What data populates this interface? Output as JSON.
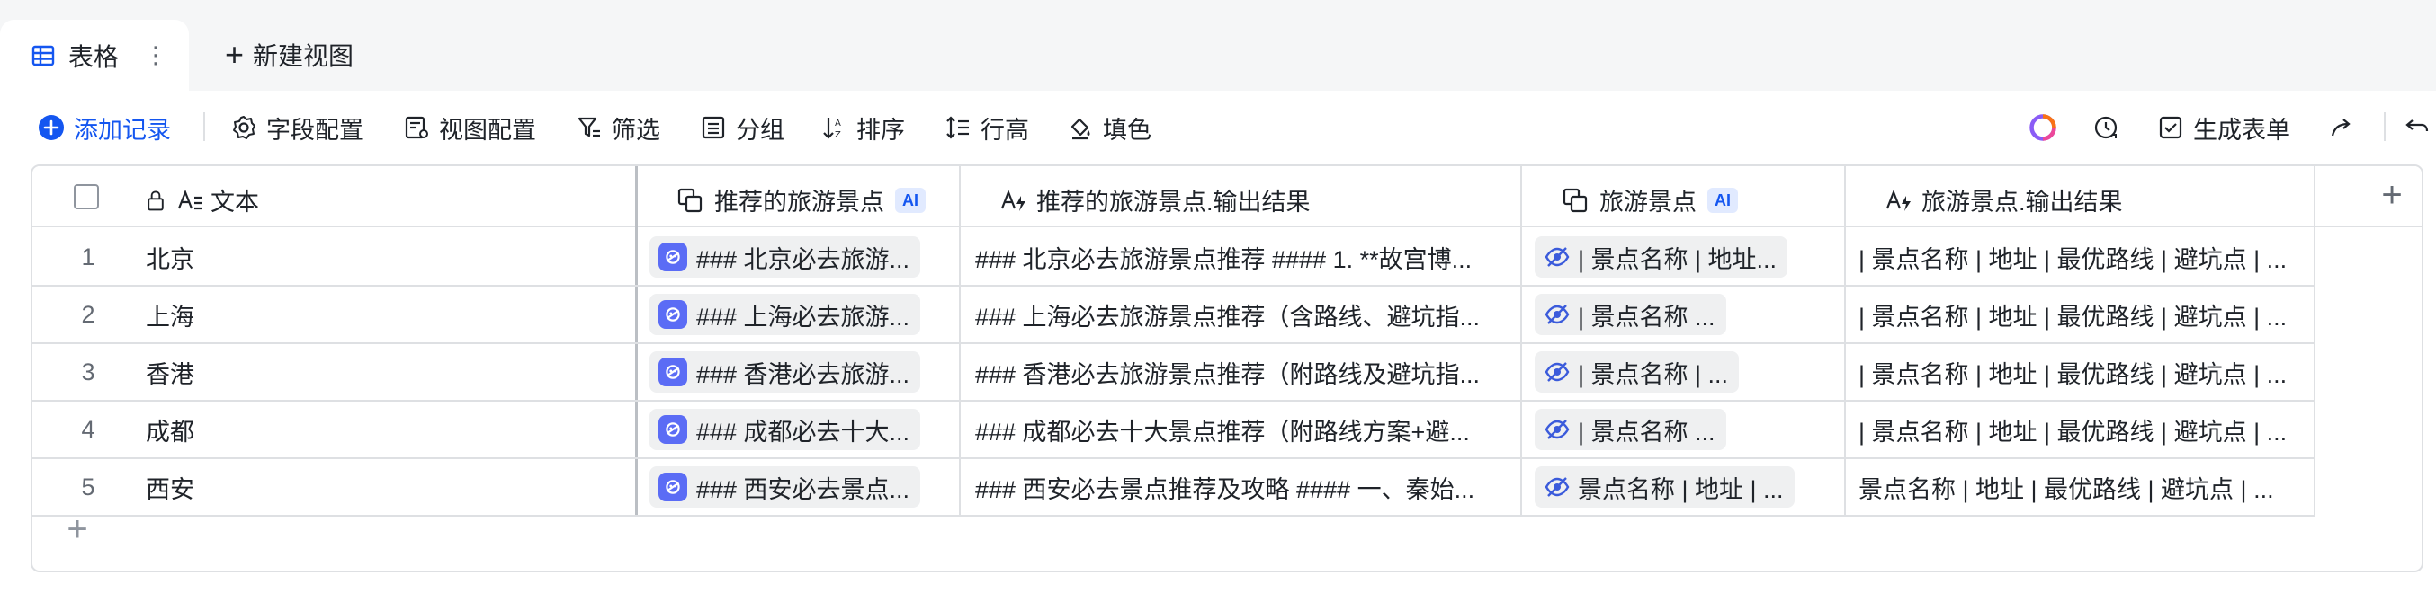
{
  "tabs": {
    "active_label": "表格",
    "more": "⋮",
    "new_view_label": "新建视图",
    "plus": "+"
  },
  "toolbar": {
    "add_record": "添加记录",
    "field_config": "字段配置",
    "view_config": "视图配置",
    "filter": "筛选",
    "group": "分组",
    "sort": "排序",
    "row_height": "行高",
    "fill": "填色",
    "generate_form": "生成表单"
  },
  "table": {
    "headers": {
      "text": "文本",
      "recommended": "推荐的旅游景点",
      "recommended_output": "推荐的旅游景点.输出结果",
      "attractions": "旅游景点",
      "attractions_output": "旅游景点.输出结果",
      "ai": "AI",
      "add_column": "+"
    },
    "rows": [
      {
        "num": "1",
        "text": "北京",
        "recommended": "### 北京必去旅游...",
        "recommended_output": "### 北京必去旅游景点推荐 #### 1. **故宫博...",
        "attractions": "| 景点名称      | 地址...",
        "attractions_output": "| 景点名称 | 地址 | 最优路线 | 避坑点 | ..."
      },
      {
        "num": "2",
        "text": "上海",
        "recommended": "### 上海必去旅游...",
        "recommended_output": "### 上海必去旅游景点推荐（含路线、避坑指...",
        "attractions": "| 景点名称                 ...",
        "attractions_output": "| 景点名称 | 地址 | 最优路线 | 避坑点 | ..."
      },
      {
        "num": "3",
        "text": "香港",
        "recommended": "### 香港必去旅游...",
        "recommended_output": "### 香港必去旅游景点推荐（附路线及避坑指...",
        "attractions": "| 景点名称            | ...",
        "attractions_output": "| 景点名称 | 地址 | 最优路线 | 避坑点 | ..."
      },
      {
        "num": "4",
        "text": "成都",
        "recommended": "### 成都必去十大...",
        "recommended_output": "### 成都必去十大景点推荐（附路线方案+避...",
        "attractions": "| 景点名称                 ...",
        "attractions_output": "| 景点名称 | 地址 | 最优路线 | 避坑点 | ..."
      },
      {
        "num": "5",
        "text": "西安",
        "recommended": "### 西安必去景点...",
        "recommended_output": "### 西安必去景点推荐及攻略 #### 一、秦始...",
        "attractions": "景点名称 | 地址 | ...",
        "attractions_output": "景点名称 | 地址 | 最优路线 | 避坑点 | ..."
      }
    ],
    "add_row": "+"
  },
  "colors": {
    "accent": "#1456f0",
    "border": "#dee0e3",
    "bot": "#5b6cf5",
    "ai_badge_bg": "#e1eaff"
  }
}
